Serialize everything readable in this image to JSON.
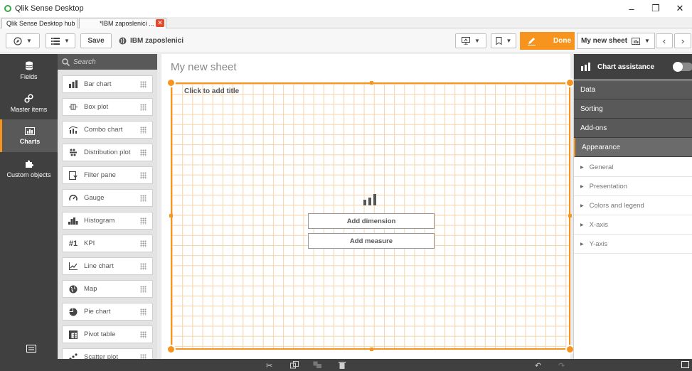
{
  "window": {
    "title": "Qlik Sense Desktop"
  },
  "tabs": [
    {
      "label": "Qlik Sense Desktop hub"
    },
    {
      "label": "*IBM zaposlenici ..."
    }
  ],
  "toolbar": {
    "save_label": "Save",
    "app_name": "IBM zaposlenici",
    "done_label": "Done",
    "sheet_name": "My new sheet"
  },
  "leftnav": {
    "items": [
      {
        "label": "Fields",
        "icon": "database-icon"
      },
      {
        "label": "Master items",
        "icon": "link-icon"
      },
      {
        "label": "Charts",
        "icon": "bar-chart-icon"
      },
      {
        "label": "Custom objects",
        "icon": "puzzle-icon"
      }
    ]
  },
  "chartpanel": {
    "search_placeholder": "Search",
    "items": [
      {
        "label": "Bar chart",
        "icon": "bar-chart-icon"
      },
      {
        "label": "Box plot",
        "icon": "box-plot-icon"
      },
      {
        "label": "Combo chart",
        "icon": "combo-chart-icon"
      },
      {
        "label": "Distribution plot",
        "icon": "distribution-plot-icon"
      },
      {
        "label": "Filter pane",
        "icon": "filter-pane-icon"
      },
      {
        "label": "Gauge",
        "icon": "gauge-icon"
      },
      {
        "label": "Histogram",
        "icon": "histogram-icon"
      },
      {
        "label": "KPI",
        "icon": "kpi-icon",
        "glyph": "#1"
      },
      {
        "label": "Line chart",
        "icon": "line-chart-icon"
      },
      {
        "label": "Map",
        "icon": "map-icon"
      },
      {
        "label": "Pie chart",
        "icon": "pie-chart-icon"
      },
      {
        "label": "Pivot table",
        "icon": "pivot-table-icon"
      },
      {
        "label": "Scatter plot",
        "icon": "scatter-plot-icon"
      }
    ]
  },
  "sheet": {
    "title": "My new sheet",
    "object_title": "Click to add title",
    "add_dimension": "Add dimension",
    "add_measure": "Add measure"
  },
  "rightpanel": {
    "assist_label": "Chart assistance",
    "sections": [
      {
        "label": "Data"
      },
      {
        "label": "Sorting"
      },
      {
        "label": "Add-ons"
      },
      {
        "label": "Appearance"
      }
    ],
    "subsections": [
      {
        "label": "General"
      },
      {
        "label": "Presentation"
      },
      {
        "label": "Colors and legend"
      },
      {
        "label": "X-axis"
      },
      {
        "label": "Y-axis"
      }
    ]
  },
  "colors": {
    "accent": "#f7941e",
    "dark": "#404040",
    "mid": "#595959"
  }
}
